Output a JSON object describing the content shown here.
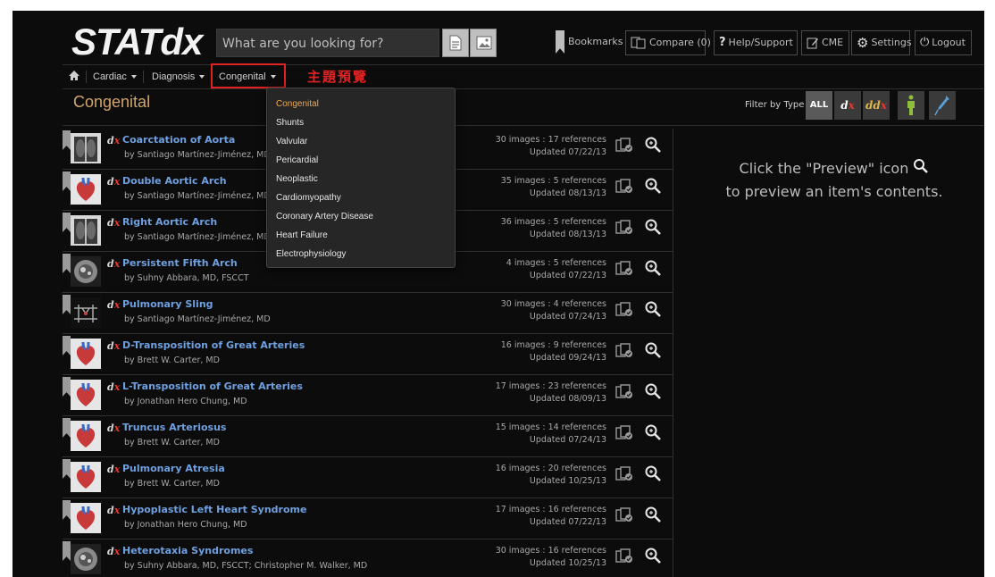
{
  "header": {
    "logo": "STATdx",
    "search_placeholder": "What are you looking for?",
    "buttons": {
      "bookmarks": "Bookmarks",
      "compare": "Compare (0)",
      "help": "Help/Support",
      "cme": "CME",
      "settings": "Settings",
      "logout": "Logout"
    }
  },
  "breadcrumb": {
    "home_icon": "home-icon",
    "items": [
      "Cardiac",
      "Diagnosis",
      "Congenital"
    ]
  },
  "annotation": "主題預覽",
  "page": {
    "title": "Congenital",
    "filter_label": "Filter by Type",
    "filters": [
      "ALL",
      "dx",
      "ddx",
      "person",
      "syringe"
    ]
  },
  "dropdown": {
    "items": [
      "Congenital",
      "Shunts",
      "Valvular",
      "Pericardial",
      "Neoplastic",
      "Cardiomyopathy",
      "Coronary Artery Disease",
      "Heart Failure",
      "Electrophysiology"
    ],
    "selected": "Congenital"
  },
  "list": [
    {
      "title": "Coarctation of Aorta",
      "author": "by Santiago Martínez-Jiménez, MD",
      "meta": "30 images : 17 references",
      "updated": "Updated 07/22/13",
      "thumb": "xray"
    },
    {
      "title": "Double Aortic Arch",
      "author": "by Santiago Martínez-Jiménez, MD",
      "meta": "35 images : 5 references",
      "updated": "Updated 08/13/13",
      "thumb": "heart"
    },
    {
      "title": "Right Aortic Arch",
      "author": "by Santiago Martínez-Jiménez, MD",
      "meta": "36 images : 5 references",
      "updated": "Updated 08/13/13",
      "thumb": "xray"
    },
    {
      "title": "Persistent Fifth Arch",
      "author": "by Suhny Abbara, MD, FSCCT",
      "meta": "4 images : 5 references",
      "updated": "Updated 07/22/13",
      "thumb": "ct"
    },
    {
      "title": "Pulmonary Sling",
      "author": "by Santiago Martínez-Jiménez, MD",
      "meta": "30 images : 4 references",
      "updated": "Updated 07/24/13",
      "thumb": "diagram"
    },
    {
      "title": "D-Transposition of Great Arteries",
      "author": "by Brett W. Carter, MD",
      "meta": "16 images : 9 references",
      "updated": "Updated 09/24/13",
      "thumb": "heart"
    },
    {
      "title": "L-Transposition of Great Arteries",
      "author": "by Jonathan Hero Chung, MD",
      "meta": "17 images : 23 references",
      "updated": "Updated 08/09/13",
      "thumb": "heart"
    },
    {
      "title": "Truncus Arteriosus",
      "author": "by Brett W. Carter, MD",
      "meta": "15 images : 14 references",
      "updated": "Updated 07/24/13",
      "thumb": "heart"
    },
    {
      "title": "Pulmonary Atresia",
      "author": "by Brett W. Carter, MD",
      "meta": "16 images : 20 references",
      "updated": "Updated 10/25/13",
      "thumb": "heart"
    },
    {
      "title": "Hypoplastic Left Heart Syndrome",
      "author": "by Jonathan Hero Chung, MD",
      "meta": "17 images : 16 references",
      "updated": "Updated 07/22/13",
      "thumb": "heart"
    },
    {
      "title": "Heterotaxia Syndromes",
      "author": "by Suhny Abbara, MD, FSCCT;  Christopher M. Walker, MD",
      "meta": "30 images : 16 references",
      "updated": "Updated 10/25/13",
      "thumb": "ct"
    }
  ],
  "preview_hint": {
    "line1": "Click the \"Preview\" icon",
    "line2": "to preview an item's contents."
  },
  "colors": {
    "title_accent": "#d2a56a",
    "link": "#6fa0e0",
    "dx_red": "#e23a2e",
    "annotation_red": "#e02222"
  }
}
